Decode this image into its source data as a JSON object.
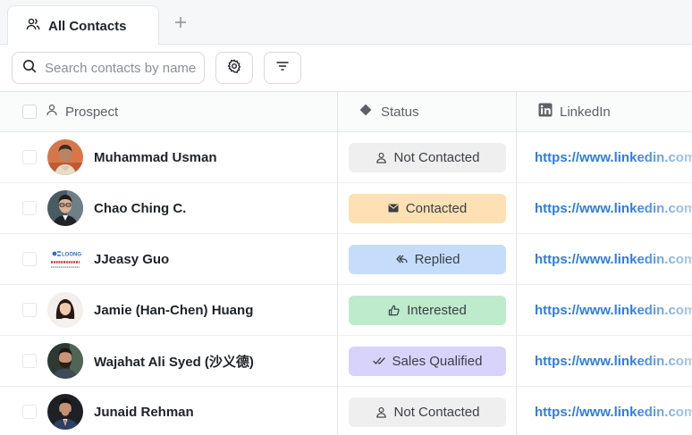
{
  "tabs": [
    {
      "label": "All Contacts"
    }
  ],
  "toolbar": {
    "search_placeholder": "Search contacts by name",
    "settings_icon": "gear-icon",
    "filter_icon": "filter-lines-icon"
  },
  "columns": {
    "prospect": "Prospect",
    "status": "Status",
    "linkedin": "LinkedIn"
  },
  "status_styles": {
    "Not Contacted": {
      "bg": "#efefef",
      "icon": "user-icon"
    },
    "Contacted": {
      "bg": "#fde0b3",
      "icon": "envelope-icon"
    },
    "Replied": {
      "bg": "#c6dcfb",
      "icon": "reply-icon"
    },
    "Interested": {
      "bg": "#bdebcc",
      "icon": "thumbs-up-icon"
    },
    "Sales Qualified": {
      "bg": "#d7d3fb",
      "icon": "double-check-icon"
    }
  },
  "rows": [
    {
      "name": "Muhammad Usman",
      "status": "Not Contacted",
      "linkedin": "https://www.linkedin.com"
    },
    {
      "name": "Chao Ching C.",
      "status": "Contacted",
      "linkedin": "https://www.linkedin.com"
    },
    {
      "name": "JJeasy Guo",
      "status": "Replied",
      "linkedin": "https://www.linkedin.com"
    },
    {
      "name": "Jamie (Han-Chen) Huang",
      "status": "Interested",
      "linkedin": "https://www.linkedin.com"
    },
    {
      "name": "Wajahat Ali Syed (沙义德)",
      "status": "Sales Qualified",
      "linkedin": "https://www.linkedin.com"
    },
    {
      "name": "Junaid Rehman",
      "status": "Not Contacted",
      "linkedin": "https://www.linkedin.com"
    }
  ]
}
